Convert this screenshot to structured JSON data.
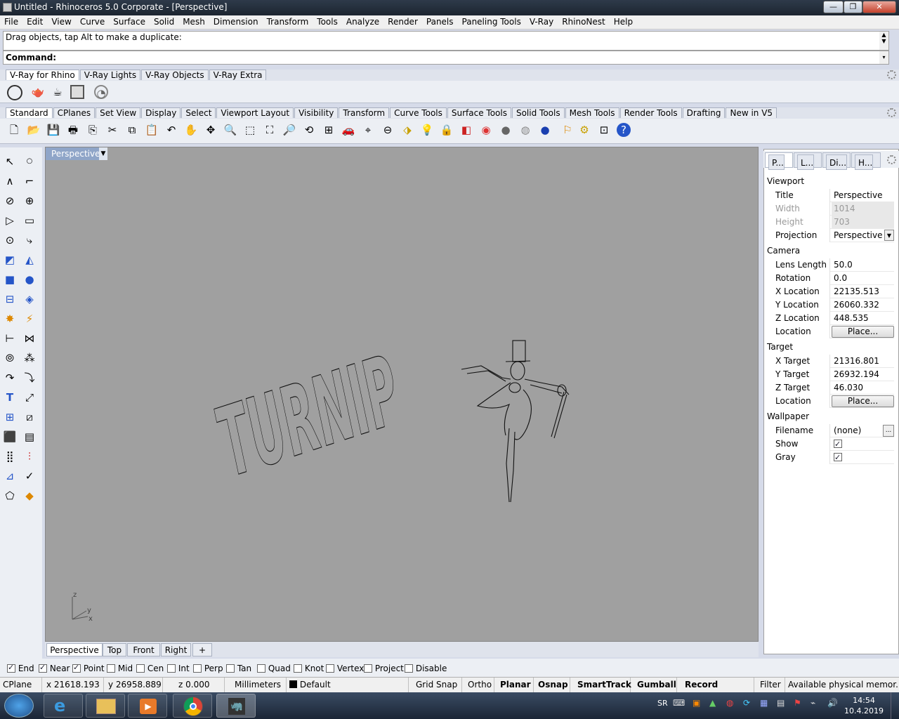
{
  "window": {
    "title": "Untitled - Rhinoceros  5.0 Corporate - [Perspective]",
    "min": "—",
    "max": "❐",
    "close": "✕"
  },
  "menu": [
    "File",
    "Edit",
    "View",
    "Curve",
    "Surface",
    "Solid",
    "Mesh",
    "Dimension",
    "Transform",
    "Tools",
    "Analyze",
    "Render",
    "Panels",
    "Paneling Tools",
    "V-Ray",
    "RhinoNest",
    "Help"
  ],
  "command": {
    "history": "Drag objects, tap Alt to make a duplicate:",
    "prompt": "Command:"
  },
  "vray_tabs": [
    "V-Ray for Rhino",
    "V-Ray Lights",
    "V-Ray Objects",
    "V-Ray Extra"
  ],
  "main_tabs": [
    "Standard",
    "CPlanes",
    "Set View",
    "Display",
    "Select",
    "Viewport Layout",
    "Visibility",
    "Transform",
    "Curve Tools",
    "Surface Tools",
    "Solid Tools",
    "Mesh Tools",
    "Render Tools",
    "Drafting",
    "New in V5"
  ],
  "viewport": {
    "title": "Perspective",
    "scene_text": "TURNIP",
    "axis_z": "z",
    "axis_y": "y",
    "axis_x": "x"
  },
  "viewport_tabs": [
    "Perspective",
    "Top",
    "Front",
    "Right",
    "+"
  ],
  "panel_tabs": [
    "P...",
    "L...",
    "Di...",
    "H..."
  ],
  "properties": {
    "viewport_header": "Viewport",
    "title_k": "Title",
    "title_v": "Perspective",
    "width_k": "Width",
    "width_v": "1014",
    "height_k": "Height",
    "height_v": "703",
    "projection_k": "Projection",
    "projection_v": "Perspective",
    "camera_header": "Camera",
    "lens_k": "Lens Length",
    "lens_v": "50.0",
    "rotation_k": "Rotation",
    "rotation_v": "0.0",
    "xloc_k": "X Location",
    "xloc_v": "22135.513",
    "yloc_k": "Y Location",
    "yloc_v": "26060.332",
    "zloc_k": "Z Location",
    "zloc_v": "448.535",
    "cam_location_k": "Location",
    "place_label": "Place...",
    "target_header": "Target",
    "xt_k": "X Target",
    "xt_v": "21316.801",
    "yt_k": "Y Target",
    "yt_v": "26932.194",
    "zt_k": "Z Target",
    "zt_v": "46.030",
    "tgt_location_k": "Location",
    "wallpaper_header": "Wallpaper",
    "filename_k": "Filename",
    "filename_v": "(none)",
    "browse": "...",
    "show_k": "Show",
    "gray_k": "Gray"
  },
  "osnaps": [
    {
      "label": "End",
      "checked": true
    },
    {
      "label": "Near",
      "checked": true
    },
    {
      "label": "Point",
      "checked": true
    },
    {
      "label": "Mid",
      "checked": false
    },
    {
      "label": "Cen",
      "checked": false
    },
    {
      "label": "Int",
      "checked": false
    },
    {
      "label": "Perp",
      "checked": false
    },
    {
      "label": "Tan",
      "checked": false
    },
    {
      "label": "Quad",
      "checked": false
    },
    {
      "label": "Knot",
      "checked": false
    },
    {
      "label": "Vertex",
      "checked": false
    },
    {
      "label": "Project",
      "checked": false
    },
    {
      "label": "Disable",
      "checked": false
    }
  ],
  "status": {
    "cplane": "CPlane",
    "x": "x 21618.193",
    "y": "y 26958.889",
    "z": "z 0.000",
    "units": "Millimeters",
    "layer": "Default",
    "gridsnap": "Grid Snap",
    "ortho": "Ortho",
    "planar": "Planar",
    "osnap": "Osnap",
    "smarttrack": "SmartTrack",
    "gumball": "Gumball",
    "history": "Record History",
    "filter": "Filter",
    "memory": "Available physical memor..."
  },
  "taskbar": {
    "lang": "SR",
    "time": "14:54",
    "date": "10.4.2019"
  }
}
